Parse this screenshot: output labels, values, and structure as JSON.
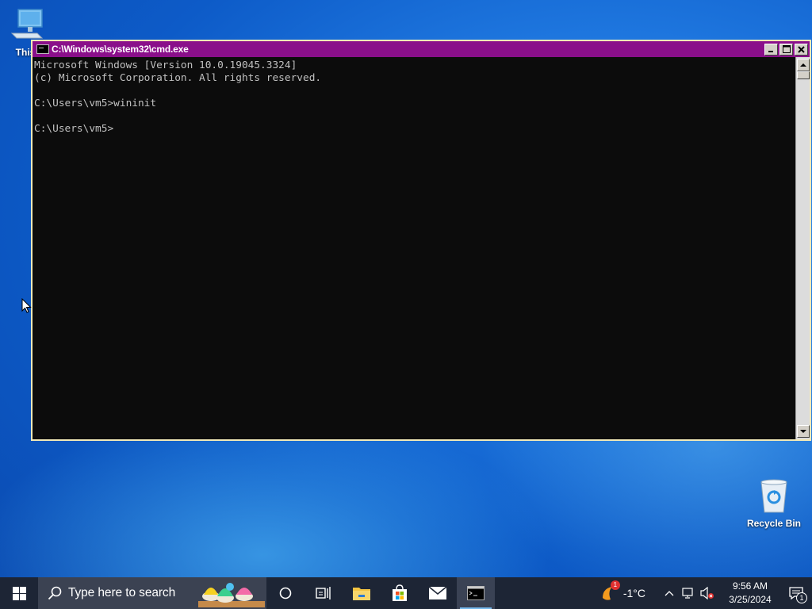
{
  "desktop": {
    "icons": [
      {
        "label": "This",
        "icon": "computer-icon"
      },
      {
        "label": "Recycle Bin",
        "icon": "recycle-bin-icon"
      }
    ]
  },
  "cmd_window": {
    "title": "C:\\Windows\\system32\\cmd.exe",
    "titlebar_color": "#8a0f8a",
    "lines": [
      "Microsoft Windows [Version 10.0.19045.3324]",
      "(c) Microsoft Corporation. All rights reserved.",
      "",
      "C:\\Users\\vm5>wininit",
      "",
      "C:\\Users\\vm5>"
    ],
    "buttons": {
      "minimize": "minimize-icon",
      "maximize": "maximize-icon",
      "close": "close-icon"
    }
  },
  "taskbar": {
    "search_placeholder": "Type here to search",
    "pinned": [
      {
        "name": "cortana",
        "icon": "cortana-circle-icon"
      },
      {
        "name": "task-view",
        "icon": "task-view-icon"
      },
      {
        "name": "file-explorer",
        "icon": "folder-icon"
      },
      {
        "name": "store",
        "icon": "store-bag-icon"
      },
      {
        "name": "mail",
        "icon": "mail-icon"
      },
      {
        "name": "cmd",
        "icon": "cmd-icon",
        "active": true
      }
    ],
    "weather": {
      "temp": "-1°C",
      "badge": "1"
    },
    "clock": {
      "time": "9:56 AM",
      "date": "3/25/2024"
    },
    "notifications_count": "1"
  }
}
